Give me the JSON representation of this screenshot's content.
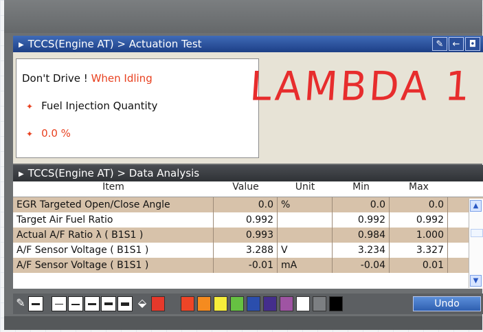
{
  "actuation": {
    "title": "TCCS(Engine AT) > Actuation Test",
    "toolbar_icons": [
      "pen-icon",
      "back-icon",
      "camera-icon"
    ],
    "warning": "Don't Drive !",
    "condition": "When Idling",
    "item": "Fuel Injection Quantity",
    "value": "0.0 %",
    "annotation": "LAMBDA 1"
  },
  "analysis": {
    "title": "TCCS(Engine AT) > Data Analysis",
    "headers": {
      "item": "Item",
      "value": "Value",
      "unit": "Unit",
      "min": "Min",
      "max": "Max"
    },
    "rows": [
      {
        "item": "EGR Targeted Open/Close Angle",
        "value": "0.0",
        "unit": "%",
        "min": "0.0",
        "max": "0.0"
      },
      {
        "item": "Target Air Fuel Ratio",
        "value": "0.992",
        "unit": "",
        "min": "0.992",
        "max": "0.992"
      },
      {
        "item": "Actual A/F Ratio λ ( B1S1 )",
        "value": "0.993",
        "unit": "",
        "min": "0.984",
        "max": "1.000"
      },
      {
        "item": "A/F Sensor Voltage ( B1S1 )",
        "value": "3.288",
        "unit": "V",
        "min": "3.234",
        "max": "3.327"
      },
      {
        "item": "A/F Sensor Voltage ( B1S1 )",
        "value": "-0.01",
        "unit": "mA",
        "min": "-0.04",
        "max": "0.01"
      }
    ]
  },
  "palette": {
    "tool_icons": [
      "pen-icon",
      "fill-bucket-icon"
    ],
    "colors": [
      "#e6392b",
      "#ee4527",
      "#f58b1f",
      "#f6ee3b",
      "#66c142",
      "#2b4ead",
      "#442e8c",
      "#9f54a3",
      "#ffffff",
      "#7c7f82",
      "#000000"
    ],
    "undo": "Undo"
  }
}
